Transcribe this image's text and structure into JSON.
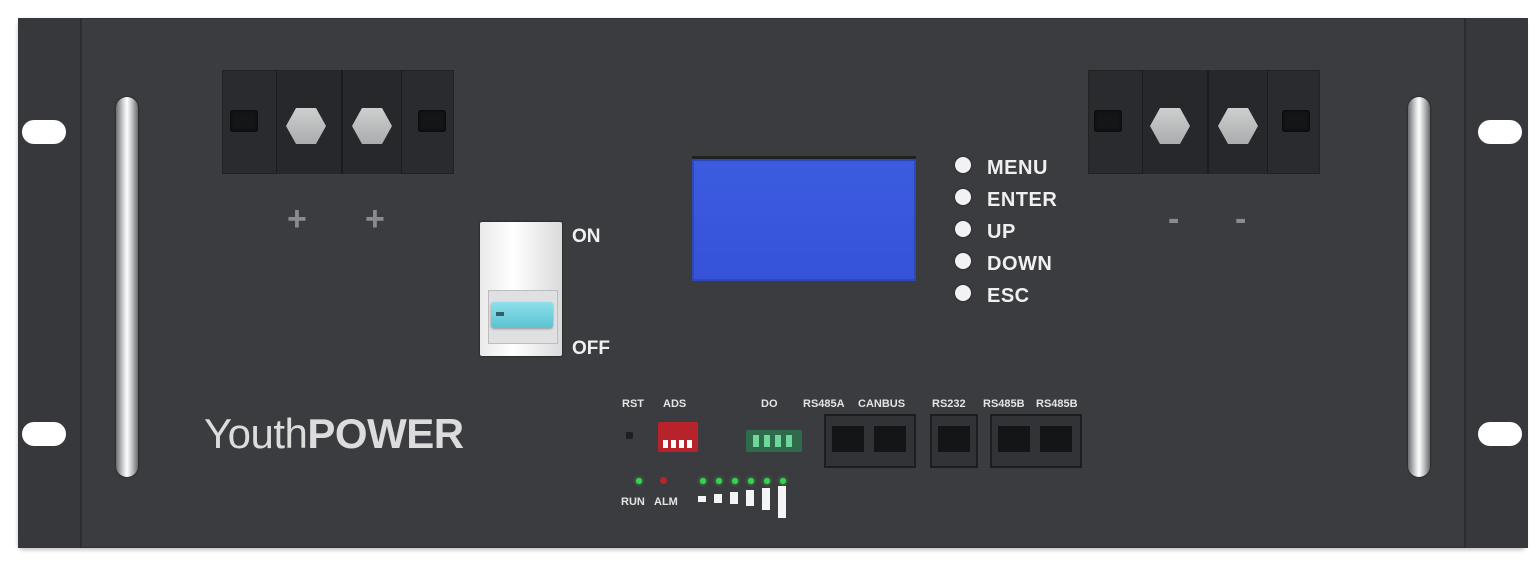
{
  "colors": {
    "chassis": "#3b3c3f",
    "lcd": "#3b58dd",
    "breaker_toggle": "#6dd0dc",
    "dip_switch": "#b8232b",
    "led_green": "#35d44b",
    "led_red": "#b6262c"
  },
  "terminals": {
    "positive_label_1": "+",
    "positive_label_2": "+",
    "negative_label_1": "-",
    "negative_label_2": "-"
  },
  "breaker": {
    "on_label": "ON",
    "off_label": "OFF"
  },
  "buttons": [
    {
      "label": "MENU"
    },
    {
      "label": "ENTER"
    },
    {
      "label": "UP"
    },
    {
      "label": "DOWN"
    },
    {
      "label": "ESC"
    }
  ],
  "brand": {
    "light": "Youth",
    "bold": "POWER"
  },
  "io_panel": {
    "rst": "RST",
    "ads": "ADS",
    "do": "DO",
    "rs485a": "RS485A",
    "canbus": "CANBUS",
    "rs232": "RS232",
    "rs485b_1": "RS485B",
    "rs485b_2": "RS485B",
    "run": "RUN",
    "alm": "ALM"
  },
  "icons": [
    "hex-bolt-icon",
    "rack-handle-icon",
    "rj45-port-icon",
    "dip-switch-icon",
    "led-icon"
  ]
}
